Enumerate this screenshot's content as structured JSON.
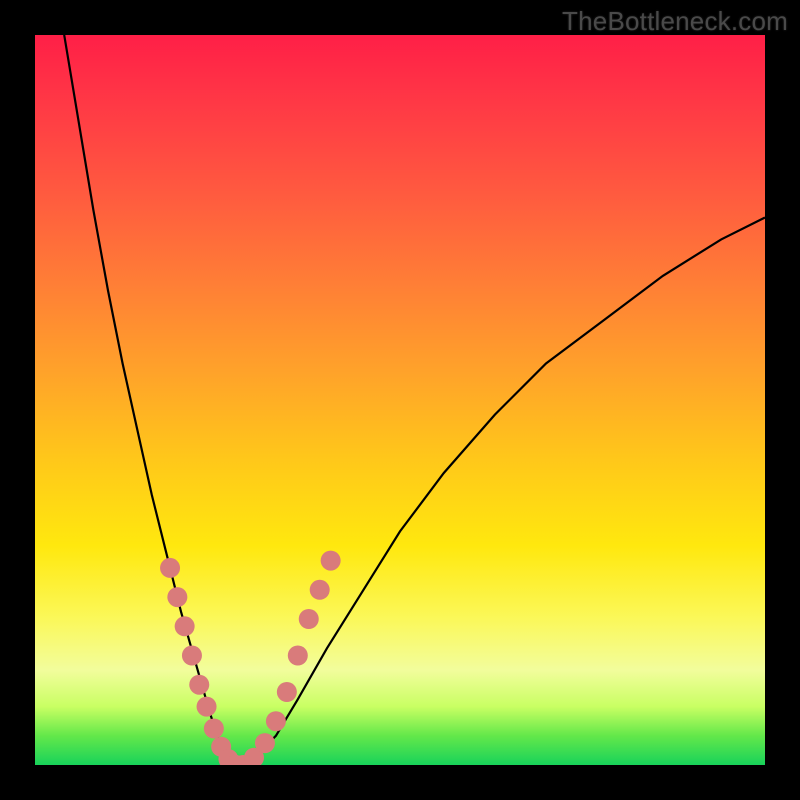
{
  "watermark": "TheBottleneck.com",
  "chart_data": {
    "type": "line",
    "title": "",
    "xlabel": "",
    "ylabel": "",
    "xlim": [
      0,
      100
    ],
    "ylim": [
      0,
      100
    ],
    "series": [
      {
        "name": "bottleneck-curve",
        "x": [
          4,
          6,
          8,
          10,
          12,
          14,
          16,
          18,
          20,
          22,
          24,
          25,
          26,
          27,
          28,
          30,
          33,
          36,
          40,
          45,
          50,
          56,
          63,
          70,
          78,
          86,
          94,
          100
        ],
        "values": [
          100,
          88,
          76,
          65,
          55,
          46,
          37,
          29,
          21,
          14,
          7,
          4,
          1,
          0,
          0,
          1,
          4,
          9,
          16,
          24,
          32,
          40,
          48,
          55,
          61,
          67,
          72,
          75
        ]
      }
    ],
    "markers": [
      {
        "x": 18.5,
        "y": 27
      },
      {
        "x": 19.5,
        "y": 23
      },
      {
        "x": 20.5,
        "y": 19
      },
      {
        "x": 21.5,
        "y": 15
      },
      {
        "x": 22.5,
        "y": 11
      },
      {
        "x": 23.5,
        "y": 8
      },
      {
        "x": 24.5,
        "y": 5
      },
      {
        "x": 25.5,
        "y": 2.5
      },
      {
        "x": 26.5,
        "y": 0.8
      },
      {
        "x": 27.5,
        "y": 0
      },
      {
        "x": 28.5,
        "y": 0
      },
      {
        "x": 30.0,
        "y": 1
      },
      {
        "x": 31.5,
        "y": 3
      },
      {
        "x": 33.0,
        "y": 6
      },
      {
        "x": 34.5,
        "y": 10
      },
      {
        "x": 36.0,
        "y": 15
      },
      {
        "x": 37.5,
        "y": 20
      },
      {
        "x": 39.0,
        "y": 24
      },
      {
        "x": 40.5,
        "y": 28
      }
    ],
    "marker_color": "#d97b7b",
    "curve_color": "#000000"
  }
}
